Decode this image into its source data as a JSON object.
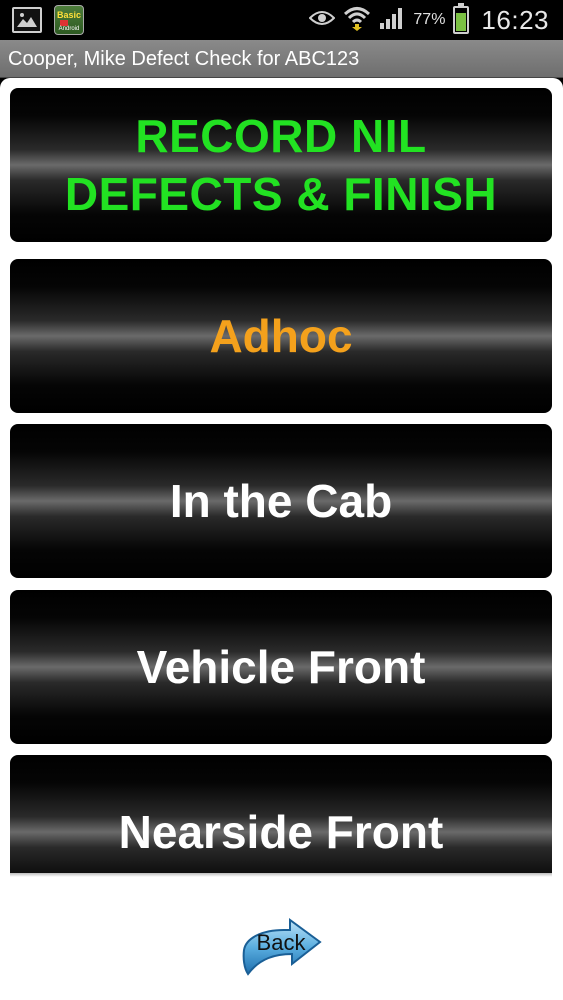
{
  "status_bar": {
    "battery_percent": "77%",
    "battery_level": 0.77,
    "time": "16:23",
    "icons": [
      "gallery-icon",
      "app-icon",
      "eye-icon",
      "wifi-icon",
      "signal-icon",
      "battery-icon"
    ],
    "app_icon_text": "Basic",
    "app_icon_subtext": "Android"
  },
  "title_bar": {
    "title": "Cooper, Mike Defect Check for ABC123"
  },
  "menu": {
    "items": [
      {
        "line1": "RECORD NIL",
        "line2": "DEFECTS & FINISH",
        "color": "#22e222"
      },
      {
        "label": "Adhoc",
        "color": "#f4a11c"
      },
      {
        "label": "In the Cab",
        "color": "#ffffff"
      },
      {
        "label": "Vehicle Front",
        "color": "#ffffff"
      },
      {
        "label": "Nearside Front",
        "color": "#ffffff"
      }
    ]
  },
  "back_button": {
    "label": "Back",
    "icon": "arrow-back-icon"
  }
}
